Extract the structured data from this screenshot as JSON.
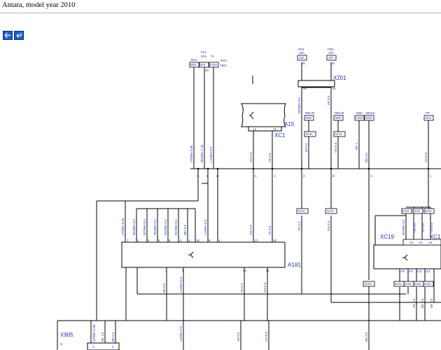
{
  "header": {
    "title": "Antara, model year 2010"
  },
  "nav": {
    "back_label": "Back",
    "forward_label": "Forward"
  },
  "components": {
    "A181": "A181",
    "A15": "A15",
    "XC1_a15": "XC1",
    "X201": "X201",
    "X905": "X905",
    "XC19": "XC19",
    "XC1_right": "XC1"
  },
  "fuses": {
    "f24_label": "F24",
    "f24_rating": "20A",
    "f24_num": "21",
    "tl_label": "TL",
    "f24_box": "402",
    "f24_box_sub": "REC",
    "tl_box": "F23A",
    "tl_box_sub": "REC",
    "f24_left_box": "B06",
    "rsc_label": "RSC",
    "f24_pin": "20",
    "fd4_label": "FD4",
    "fd4_rating": "15A",
    "fd4_box": "450",
    "fd4_pin": "30",
    "fd5_label": "FD5",
    "fd5_rating": "15A",
    "fd5_box": "397",
    "fd5_pin": "15",
    "blk_label": "BLK",
    "blk_box": "B08",
    "x201_pin_left": "90",
    "x201_pin_right": "91",
    "rbcm_label": "RBCM",
    "rbcm_box": "B95",
    "rbcm2_label": "RBCM",
    "rbcm2_box": "B89",
    "rbc_label": "RBC",
    "rbc_box": "1258",
    "sbcm_label": "SBCM",
    "sbcm_box": "B28",
    "pp_label": "PP",
    "pp_box": "B15"
  },
  "wires": {
    "vt_wh_085_top": "VT/WH 0.85",
    "rd_wh_135": "RD/WH 1.35",
    "lg_wh_05": "LG/WH 0.5",
    "og_03": "OG 0.3",
    "ye_03": "YE 0.3",
    "rd_wh_05_x201": "RD/WH 0.5",
    "pk_05": "PK 0.5",
    "ye_03_r": "YE 0.3",
    "gn_03": "GN 0.3",
    "rd_1": "RD 1",
    "bn_05": "BN 0.5",
    "gn_05": "GN 0.5",
    "vt_wh_085_a": "VT/WH 0.85",
    "rd_wh_05_1": "RD/WH 0.5",
    "rd_wh_05_2": "RD/WH 0.5",
    "rd_wh_05_3": "RD/WH 0.5",
    "rd_wh_05_4": "RD/WH 0.5",
    "rd_wh_05_5": "RD/WH 0.5",
    "wh_05": "WH 0.5",
    "lg_wh_05_a": "LG/WH 0.5",
    "og_03_a": "OG 0.3",
    "ye_03_a": "YE 0.3",
    "ye_03_b": "YE 0.3",
    "gn_03_b": "GN 0.3",
    "bk_05_a": "BK 0.5",
    "lg_wh_05_b": "LG/WH 0.5",
    "ye_03_c": "YE 0.3",
    "gn_03_c": "GN 0.3",
    "rd_wh_05_r": "RD/WH 0.5",
    "pk_05_r": "PK 0.5",
    "ye_05_r": "YE 0.5",
    "gn_05_r": "GN 0.5",
    "bk_05_r1": "BK 0.5",
    "bk_05_r2": "BK 0.5",
    "ye_03_r2": "YE 0.3",
    "vt_wh_085_b": "VT/WH 0.85",
    "bk_15": "BK 1.5",
    "bk_03": "BK 0.3",
    "lg_wh_05_c": "LG/WH 0.5",
    "ye_05_b": "YE 0.5",
    "gn_05_b": "GN 0.5",
    "bk_05_b": "BK 0.5"
  },
  "splice_letters": {
    "g": "G",
    "e": "E",
    "h": "H",
    "k": "K",
    "j": "J",
    "c": "C",
    "b": "B",
    "s": "S",
    "l": "L"
  },
  "a181_pins": {
    "top": [
      "7",
      "2",
      "5",
      "9",
      "8",
      "12",
      "13",
      "16",
      "6",
      "4",
      "13",
      "10"
    ],
    "bottom": [
      "2",
      "1",
      "14",
      "11"
    ]
  },
  "a15_pins": {
    "left": "13",
    "right": "12"
  },
  "xc19_pins": [
    "A2",
    "A3",
    "A5"
  ],
  "xc19_bottom_pins": [
    "A10",
    "A11",
    "A12",
    "A13"
  ],
  "x905_pins": [
    "N",
    "1",
    "3"
  ],
  "dan_labels": {
    "d1": "DAN",
    "d2": "DAN",
    "d3": "DAN",
    "d4": "DAN",
    "d5": "DAN",
    "d6": "DAN",
    "d7": "DAN",
    "d8": "DAN",
    "d9": "DAN",
    "d10": "DAN",
    "d11": "DAN",
    "d12": "DAN",
    "d13": "DAN"
  },
  "colors": {
    "ink": "#000000",
    "label": "#1f33c8",
    "nav": "#1a5fcf"
  }
}
